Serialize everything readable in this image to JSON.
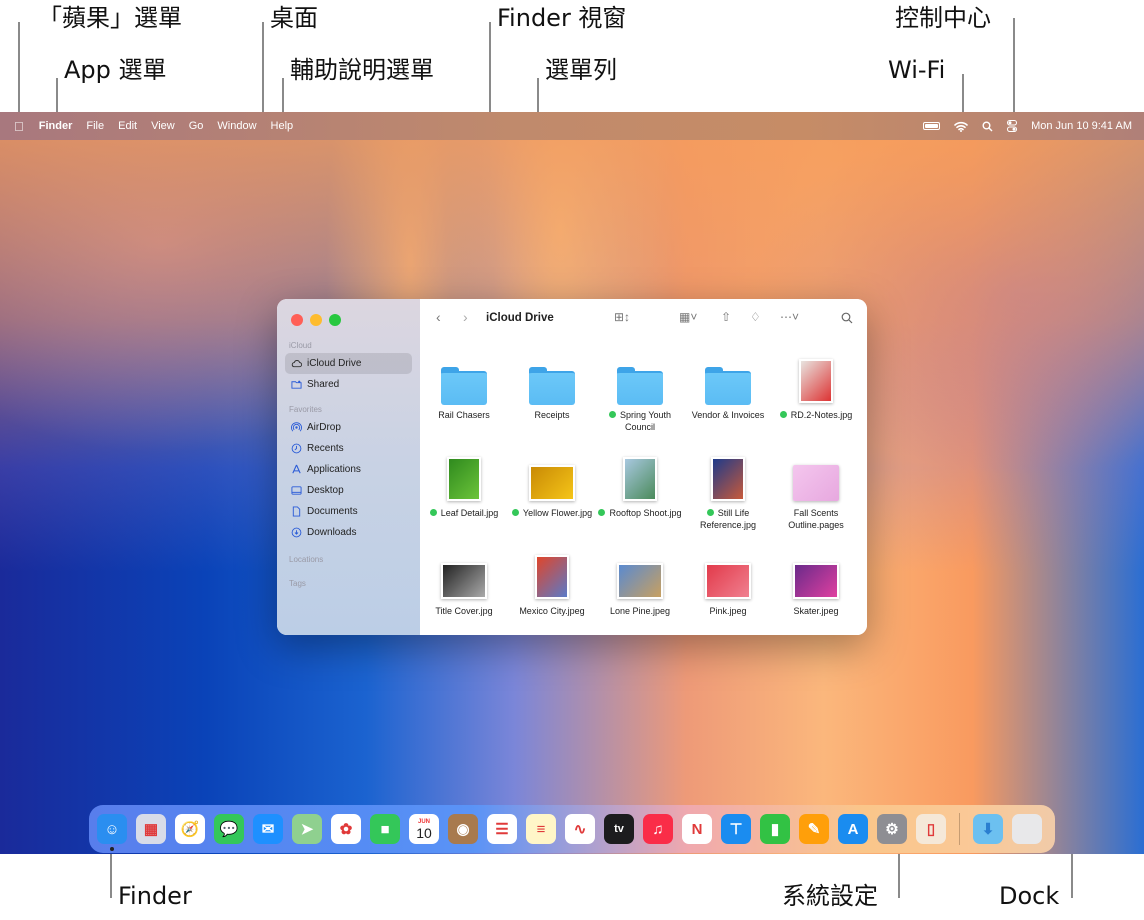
{
  "callouts": {
    "apple_menu": "「蘋果」選單",
    "app_menu": "App 選單",
    "desktop": "桌面",
    "help_menu": "輔助說明選單",
    "finder_window": "Finder 視窗",
    "menu_bar": "選單列",
    "control_center": "控制中心",
    "wifi": "Wi-Fi",
    "finder": "Finder",
    "system_settings": "系統設定",
    "dock": "Dock"
  },
  "menubar": {
    "apple_icon": "apple-icon",
    "items": [
      "Finder",
      "File",
      "Edit",
      "View",
      "Go",
      "Window",
      "Help"
    ],
    "clock": "Mon Jun 10  9:41 AM"
  },
  "finder": {
    "title": "iCloud Drive",
    "sidebar": {
      "sections": [
        {
          "heading": "iCloud",
          "items": [
            {
              "label": "iCloud Drive",
              "icon": "cloud-icon",
              "selected": true
            },
            {
              "label": "Shared",
              "icon": "shared-folder-icon"
            }
          ]
        },
        {
          "heading": "Favorites",
          "items": [
            {
              "label": "AirDrop",
              "icon": "airdrop-icon"
            },
            {
              "label": "Recents",
              "icon": "clock-icon"
            },
            {
              "label": "Applications",
              "icon": "applications-icon"
            },
            {
              "label": "Desktop",
              "icon": "desktop-icon"
            },
            {
              "label": "Documents",
              "icon": "document-icon"
            },
            {
              "label": "Downloads",
              "icon": "download-icon"
            }
          ]
        },
        {
          "heading": "Locations",
          "items": []
        },
        {
          "heading": "Tags",
          "items": []
        }
      ]
    },
    "files": [
      {
        "name": "Rail Chasers",
        "kind": "folder",
        "tag": false
      },
      {
        "name": "Receipts",
        "kind": "folder",
        "tag": false
      },
      {
        "name": "Spring Youth Council",
        "kind": "folder",
        "tag": true
      },
      {
        "name": "Vendor & Invoices",
        "kind": "folder",
        "tag": false
      },
      {
        "name": "RD.2-Notes.jpg",
        "kind": "photo",
        "tag": true,
        "colors": [
          "#e8e4e0",
          "#d33"
        ]
      },
      {
        "name": "Leaf Detail.jpg",
        "kind": "photo",
        "tag": true,
        "colors": [
          "#2f8a1e",
          "#6cc43a"
        ]
      },
      {
        "name": "Yellow Flower.jpg",
        "kind": "photo",
        "tag": true,
        "colors": [
          "#c98a05",
          "#f5c518"
        ]
      },
      {
        "name": "Rooftop Shoot.jpg",
        "kind": "photo",
        "tag": true,
        "colors": [
          "#a8c8e0",
          "#4a8a5a"
        ]
      },
      {
        "name": "Still Life Reference.jpg",
        "kind": "photo",
        "tag": true,
        "colors": [
          "#1e3a8a",
          "#c85a3a"
        ]
      },
      {
        "name": "Fall Scents Outline.pages",
        "kind": "document",
        "tag": false,
        "colors": [
          "#f4c6ee",
          "#e7a8df"
        ]
      },
      {
        "name": "Title Cover.jpg",
        "kind": "photo",
        "tag": false,
        "colors": [
          "#222",
          "#aaa"
        ]
      },
      {
        "name": "Mexico City.jpeg",
        "kind": "photo",
        "tag": false,
        "colors": [
          "#e0452a",
          "#5a7ac8"
        ]
      },
      {
        "name": "Lone Pine.jpeg",
        "kind": "photo",
        "tag": false,
        "colors": [
          "#5a8ad0",
          "#c8a060"
        ]
      },
      {
        "name": "Pink.jpeg",
        "kind": "photo",
        "tag": false,
        "colors": [
          "#e23a4a",
          "#f08090"
        ]
      },
      {
        "name": "Skater.jpeg",
        "kind": "photo",
        "tag": false,
        "colors": [
          "#6a2a8a",
          "#e040a0"
        ]
      }
    ]
  },
  "dock": {
    "apps": [
      {
        "name": "Finder",
        "icon": "finder-icon",
        "bg": "#2a8ef0",
        "glyph": "☺",
        "running": true
      },
      {
        "name": "Launchpad",
        "icon": "launchpad-icon",
        "bg": "#d8dce8",
        "glyph": "▦"
      },
      {
        "name": "Safari",
        "icon": "safari-icon",
        "bg": "#ffffff",
        "glyph": "🧭"
      },
      {
        "name": "Messages",
        "icon": "messages-icon",
        "bg": "#34c759",
        "glyph": "💬"
      },
      {
        "name": "Mail",
        "icon": "mail-icon",
        "bg": "#1e90ff",
        "glyph": "✉"
      },
      {
        "name": "Maps",
        "icon": "maps-icon",
        "bg": "#8fd08f",
        "glyph": "➤"
      },
      {
        "name": "Photos",
        "icon": "photos-icon",
        "bg": "#ffffff",
        "glyph": "✿"
      },
      {
        "name": "FaceTime",
        "icon": "facetime-icon",
        "bg": "#34c759",
        "glyph": "■"
      },
      {
        "name": "Calendar",
        "icon": "calendar-icon",
        "bg": "#ffffff",
        "glyph": "10",
        "month": "JUN"
      },
      {
        "name": "Contacts",
        "icon": "contacts-icon",
        "bg": "#a87a4e",
        "glyph": "◉"
      },
      {
        "name": "Reminders",
        "icon": "reminders-icon",
        "bg": "#ffffff",
        "glyph": "☰"
      },
      {
        "name": "Notes",
        "icon": "notes-icon",
        "bg": "#fff6c8",
        "glyph": "≡"
      },
      {
        "name": "Freeform",
        "icon": "freeform-icon",
        "bg": "#ffffff",
        "glyph": "∿"
      },
      {
        "name": "Apple TV",
        "icon": "tv-icon",
        "bg": "#1c1c1e",
        "glyph": "tv"
      },
      {
        "name": "Music",
        "icon": "music-icon",
        "bg": "#fa2d48",
        "glyph": "♫"
      },
      {
        "name": "News",
        "icon": "news-icon",
        "bg": "#ffffff",
        "glyph": "N"
      },
      {
        "name": "Keynote",
        "icon": "keynote-icon",
        "bg": "#1a8cf0",
        "glyph": "⊤"
      },
      {
        "name": "Numbers",
        "icon": "numbers-icon",
        "bg": "#32c244",
        "glyph": "▮"
      },
      {
        "name": "Pages",
        "icon": "pages-icon",
        "bg": "#ff9f0a",
        "glyph": "✎"
      },
      {
        "name": "App Store",
        "icon": "app-store-icon",
        "bg": "#1a8cf0",
        "glyph": "A"
      },
      {
        "name": "System Settings",
        "icon": "gear-icon",
        "bg": "#8e8e93",
        "glyph": "⚙"
      },
      {
        "name": "iPhone Mirroring",
        "icon": "iphone-icon",
        "bg": "#f5e8d8",
        "glyph": "▯"
      }
    ],
    "stack": [
      {
        "name": "Downloads",
        "icon": "downloads-folder-icon",
        "bg": "#6cc0f0",
        "glyph": "⬇"
      },
      {
        "name": "Trash",
        "icon": "trash-icon",
        "bg": "#e8e8ea",
        "glyph": ""
      }
    ]
  }
}
